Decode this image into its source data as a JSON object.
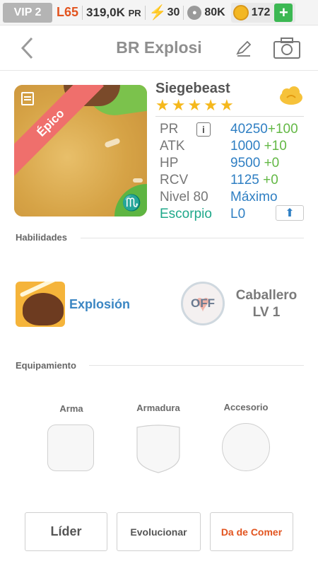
{
  "status": {
    "vip": "VIP 2",
    "level": "L65",
    "power_value": "319,0K",
    "power_unit": "PR",
    "energy": "30",
    "paws": "80K",
    "coins": "172",
    "plus": "+"
  },
  "header": {
    "title": "BR Explosi",
    "back_icon": "chevron-left-icon",
    "edit_icon": "pencil-icon",
    "camera_icon": "camera-icon"
  },
  "card": {
    "rarity": "Épico",
    "zodiac_symbol": "♏"
  },
  "creature": {
    "name": "Siegebeast",
    "stars": 5,
    "stats": [
      {
        "label": "PR",
        "value": "40250",
        "inc": "+100"
      },
      {
        "label": "ATK",
        "value": "1000",
        "inc": "+10"
      },
      {
        "label": "HP",
        "value": "9500",
        "inc": "+0"
      },
      {
        "label": "RCV",
        "value": "1125",
        "inc": "+0"
      }
    ],
    "level_label": "Nivel 80",
    "level_value": "Máximo",
    "zodiac_label": "Escorpio",
    "zodiac_value": "L0"
  },
  "skills": {
    "heading": "Habilidades",
    "skill_name": "Explosión",
    "badge": "OFF",
    "leader_line1": "Caballero",
    "leader_line2": "LV 1"
  },
  "equipment": {
    "heading": "Equipamiento",
    "weapon": "Arma",
    "armor": "Armadura",
    "accessory": "Accesorio"
  },
  "buttons": {
    "leader": "Líder",
    "evolve": "Evolucionar",
    "feed": "Da de Comer"
  },
  "colors": {
    "accent_orange": "#e2541f",
    "stat_blue": "#2f7fc3",
    "stat_green": "#63b845",
    "zodiac_teal": "#1fa88a",
    "star_gold": "#f5b81c",
    "ribbon_red": "#ef6f6c"
  }
}
